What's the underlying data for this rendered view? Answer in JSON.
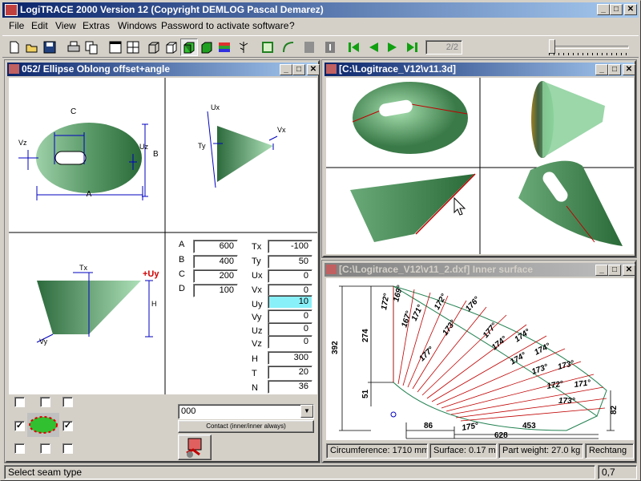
{
  "app": {
    "title": "LogiTRACE 2000  Version 12  (Copyright DEMLOG Pascal Demarez)",
    "min": "_",
    "max": "□",
    "close": "✕"
  },
  "menu": [
    "File",
    "Edit",
    "View",
    "Extras",
    "Windows",
    "Password to activate software",
    "?"
  ],
  "toolbar": {
    "page": "2/2"
  },
  "win1": {
    "title": "052/ Ellipse Oblong offset+angle"
  },
  "win2": {
    "title": "[C:\\Logitrace_V12\\v11.3d]"
  },
  "win3": {
    "title": "[C:\\Logitrace_V12\\v11_2.dxf]  Inner surface"
  },
  "dims": {
    "c": "C",
    "a": "A",
    "b": "B",
    "vz": "Vz",
    "uz": "Uz",
    "ux": "Ux",
    "vx": "Vx",
    "ty": "Ty",
    "tx": "Tx",
    "uy": "+Uy",
    "h": "H",
    "vy": "Vy",
    "plus": "+",
    "minus": "-"
  },
  "params_left": [
    {
      "label": "A",
      "value": "600"
    },
    {
      "label": "B",
      "value": "400"
    },
    {
      "label": "C",
      "value": "200"
    },
    {
      "label": "D",
      "value": "100"
    }
  ],
  "params_right": [
    {
      "label": "Tx",
      "value": "-100"
    },
    {
      "label": "Ty",
      "value": "50"
    },
    {
      "label": "Ux",
      "value": "0"
    },
    {
      "label": "Vx",
      "value": "0"
    },
    {
      "label": "Uy",
      "value": "10"
    },
    {
      "label": "Vy",
      "value": "0"
    },
    {
      "label": "Uz",
      "value": "0"
    },
    {
      "label": "Vz",
      "value": "0"
    }
  ],
  "params_extra": [
    {
      "label": "H",
      "value": "300"
    },
    {
      "label": "T",
      "value": "20"
    },
    {
      "label": "N",
      "value": "36"
    }
  ],
  "combo": {
    "value": "000",
    "arrow": "▼"
  },
  "contact_button": "Contact (inner/inner always)",
  "flat": {
    "angles": [
      "172°",
      "169°",
      "167°",
      "171°",
      "172°",
      "173°",
      "177°",
      "176°",
      "177°",
      "174°",
      "174°",
      "174°",
      "174°",
      "173°",
      "173°",
      "172°",
      "171°",
      "173°",
      "175°"
    ],
    "dims": [
      "392",
      "274",
      "51",
      "86",
      "453",
      "628",
      "82"
    ]
  },
  "info": {
    "circumference": "Circumference: 1710 mm",
    "surface": "Surface: 0.17 m²",
    "weight": "Part weight: 27.0 kg",
    "shape": "Rechtang"
  },
  "status": {
    "message": "Select seam type",
    "value": "0,7"
  },
  "colors": {
    "title_active": "#0a246a",
    "surface_green": "#6fae78",
    "highlight": "#88f0f8"
  }
}
